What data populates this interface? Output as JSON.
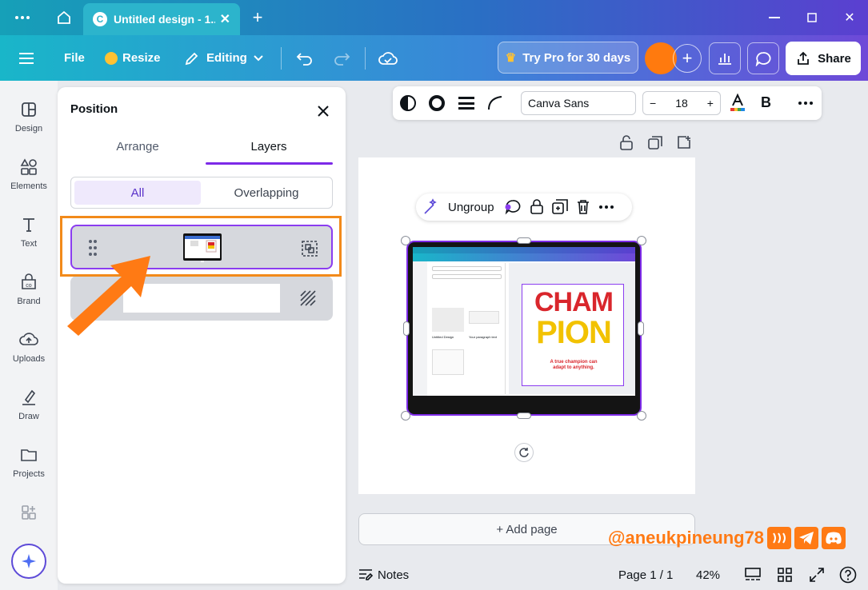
{
  "window": {
    "tab_title": "Untitled design - 1...",
    "tab_icon_letter": "C"
  },
  "toolbar": {
    "file_label": "File",
    "resize_label": "Resize",
    "editing_label": "Editing",
    "try_pro_label": "Try Pro for 30 days",
    "share_label": "Share"
  },
  "sidebar": {
    "items": [
      {
        "label": "Design",
        "icon": "design-icon"
      },
      {
        "label": "Elements",
        "icon": "elements-icon"
      },
      {
        "label": "Text",
        "icon": "text-icon"
      },
      {
        "label": "Brand",
        "icon": "brand-icon"
      },
      {
        "label": "Uploads",
        "icon": "uploads-icon"
      },
      {
        "label": "Draw",
        "icon": "draw-icon"
      },
      {
        "label": "Projects",
        "icon": "projects-icon"
      }
    ]
  },
  "panel": {
    "title": "Position",
    "tabs": [
      "Arrange",
      "Layers"
    ],
    "active_tab": "Layers",
    "segments": [
      "All",
      "Overlapping"
    ],
    "active_segment": "All"
  },
  "canvas_toolbar": {
    "font": "Canva Sans",
    "font_size": "18",
    "bold_label": "B"
  },
  "context_menu": {
    "ungroup_label": "Ungroup"
  },
  "laptop_screen": {
    "headline_1": "CHAM",
    "headline_2": "PION",
    "quote": "A true champion can adapt to anything.",
    "design_label": "Untitled Design",
    "side_label": "Your paragraph text"
  },
  "add_page_label": "+ Add page",
  "bottom": {
    "notes_label": "Notes",
    "page_label": "Page 1 / 1",
    "zoom_label": "42%"
  },
  "watermark": "@aneukpineung78",
  "colors": {
    "accent": "#7d2ae8",
    "avatar": "#ff7a0e",
    "highlight": "#f28a1a"
  }
}
